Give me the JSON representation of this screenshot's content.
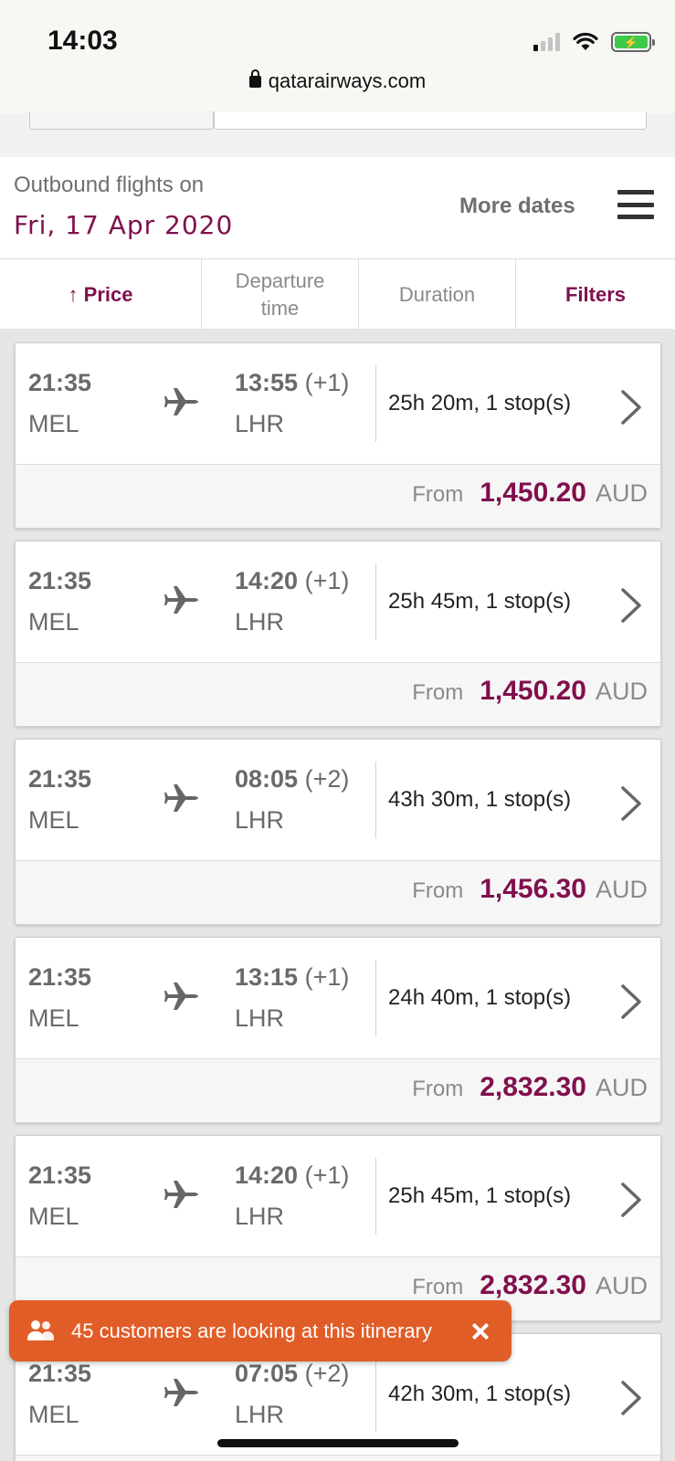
{
  "status_bar": {
    "time": "14:03"
  },
  "browser": {
    "url": "qatarairways.com"
  },
  "outbound": {
    "label": "Outbound flights on",
    "date": "Fri, 17 Apr 2020",
    "more_dates": "More dates"
  },
  "sort_tabs": {
    "price": "↑ Price",
    "departure_line1": "Departure",
    "departure_line2": "time",
    "duration": "Duration",
    "filters": "Filters"
  },
  "from_label": "From",
  "flights": [
    {
      "dep_time": "21:35",
      "dep_airport": "MEL",
      "arr_time": "13:55",
      "arr_offset": "(+1)",
      "arr_airport": "LHR",
      "duration": "25h 20m, 1 stop(s)",
      "price": "1,450.20",
      "currency": "AUD"
    },
    {
      "dep_time": "21:35",
      "dep_airport": "MEL",
      "arr_time": "14:20",
      "arr_offset": "(+1)",
      "arr_airport": "LHR",
      "duration": "25h 45m, 1 stop(s)",
      "price": "1,450.20",
      "currency": "AUD"
    },
    {
      "dep_time": "21:35",
      "dep_airport": "MEL",
      "arr_time": "08:05",
      "arr_offset": "(+2)",
      "arr_airport": "LHR",
      "duration": "43h 30m, 1 stop(s)",
      "price": "1,456.30",
      "currency": "AUD"
    },
    {
      "dep_time": "21:35",
      "dep_airport": "MEL",
      "arr_time": "13:15",
      "arr_offset": "(+1)",
      "arr_airport": "LHR",
      "duration": "24h 40m, 1 stop(s)",
      "price": "2,832.30",
      "currency": "AUD"
    },
    {
      "dep_time": "21:35",
      "dep_airport": "MEL",
      "arr_time": "14:20",
      "arr_offset": "(+1)",
      "arr_airport": "LHR",
      "duration": "25h 45m, 1 stop(s)",
      "price": "2,832.30",
      "currency": "AUD"
    },
    {
      "dep_time": "21:35",
      "dep_airport": "MEL",
      "arr_time": "07:05",
      "arr_offset": "(+2)",
      "arr_airport": "LHR",
      "duration": "42h 30m, 1 stop(s)"
    }
  ],
  "toast": {
    "text": "45 customers are looking at this itinerary",
    "icon": "people-icon",
    "color": "#e15d27"
  },
  "colors": {
    "brand": "#80104d",
    "muted_text": "#6f6f6f"
  }
}
